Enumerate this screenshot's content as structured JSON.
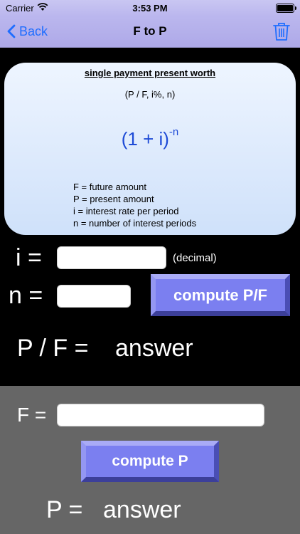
{
  "status_bar": {
    "carrier": "Carrier",
    "time": "3:53 PM"
  },
  "nav": {
    "back_label": "Back",
    "title": "F to P"
  },
  "card": {
    "title": "single payment present worth",
    "notation": "(P / F, i%, n)",
    "formula_base": "(1 + i)",
    "formula_exponent": "-n",
    "definitions": [
      "F = future amount",
      "P = present amount",
      "i = interest rate per period",
      "n = number of interest periods"
    ]
  },
  "factor_form": {
    "i_label": "i =",
    "i_value": "",
    "i_hint": "(decimal)",
    "n_label": "n =",
    "n_value": "",
    "compute_label": "compute P/F",
    "result_label": "P / F =",
    "result_value": "answer"
  },
  "present_form": {
    "f_label": "F =",
    "f_value": "",
    "compute_label": "compute P",
    "result_label": "P =",
    "result_value": "answer"
  },
  "colors": {
    "accent": "#1e6dff",
    "nav_bg": "#b9b6ee",
    "card_bg": "#dbe8fb",
    "formula": "#1e4bd6",
    "button": "#7b7ff0",
    "top_panel": "#000000",
    "bottom_panel": "#666666"
  }
}
